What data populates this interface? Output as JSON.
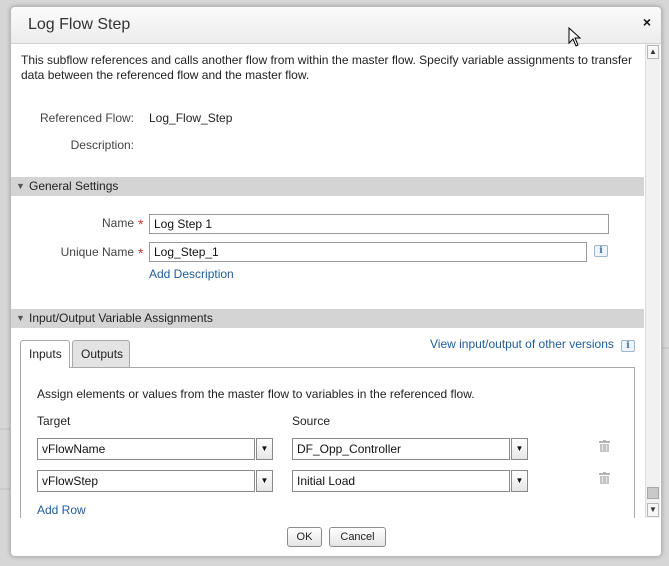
{
  "dialog": {
    "title": "Log Flow Step",
    "close_glyph": "×"
  },
  "intro": "This subflow references and calls another flow from within the master flow. Specify variable assignments to transfer data between the referenced flow and the master flow.",
  "details": {
    "referenced_flow_label": "Referenced Flow:",
    "referenced_flow_value": "Log_Flow_Step",
    "description_label": "Description:"
  },
  "general_settings": {
    "header": "General Settings",
    "name_label": "Name",
    "name_value": "Log Step 1",
    "unique_name_label": "Unique Name",
    "unique_name_value": "Log_Step_1",
    "required_mark": "*",
    "info_glyph": "i",
    "add_description": "Add Description"
  },
  "io_section": {
    "header": "Input/Output Variable Assignments",
    "tabs": [
      {
        "label": "Inputs",
        "active": true
      },
      {
        "label": "Outputs",
        "active": false
      }
    ],
    "view_other_versions": "View input/output of other versions",
    "info_glyph": "i",
    "instructions": "Assign elements or values from the master flow to variables in the referenced flow.",
    "target_header": "Target",
    "source_header": "Source",
    "rows": [
      {
        "target": "vFlowName",
        "source": "DF_Opp_Controller"
      },
      {
        "target": "vFlowStep",
        "source": "Initial Load"
      }
    ],
    "add_row": "Add Row"
  },
  "footer": {
    "ok_label": "OK",
    "cancel_label": "Cancel"
  },
  "colors": {
    "link": "#1f5c99",
    "section_header": "#d4d4d4",
    "required": "#c0392b"
  }
}
